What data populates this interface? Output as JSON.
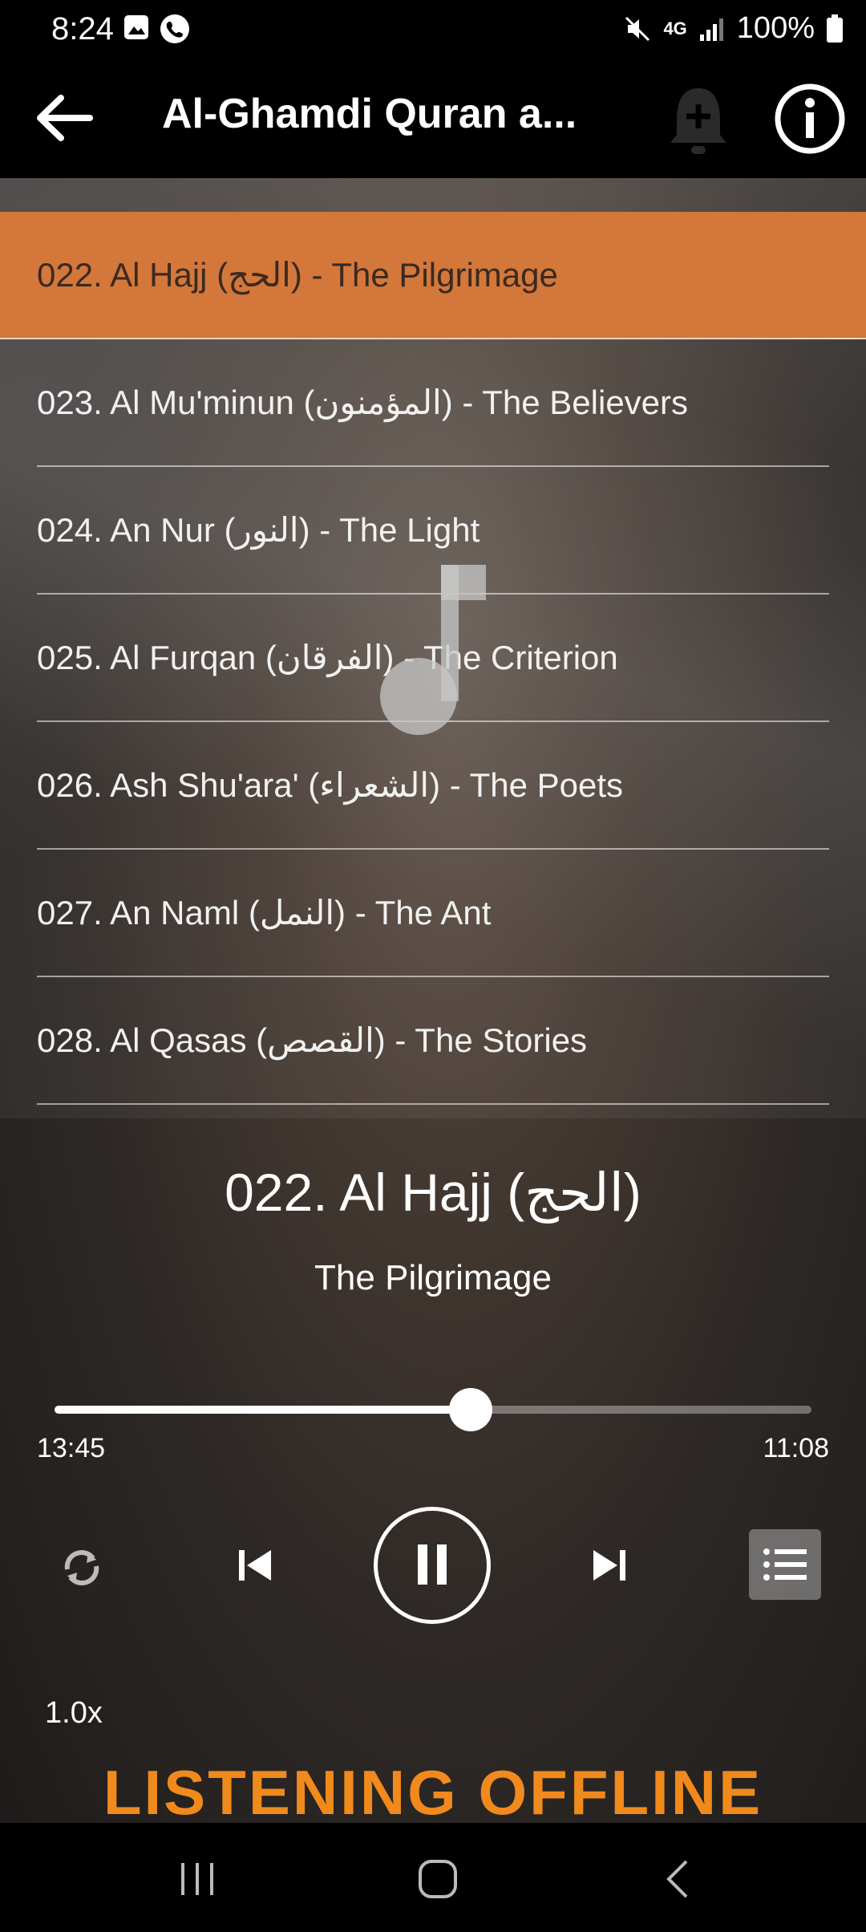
{
  "status_bar": {
    "time": "8:24",
    "network": "4G",
    "battery": "100%"
  },
  "app_bar": {
    "title": "Al-Ghamdi Quran a..."
  },
  "playlist": {
    "items": [
      {
        "label": "022. Al Hajj (الحج) - The Pilgrimage",
        "active": true
      },
      {
        "label": "023. Al Mu'minun (المؤمنون) - The Believers",
        "active": false
      },
      {
        "label": "024. An Nur (النور) - The Light",
        "active": false
      },
      {
        "label": "025. Al Furqan (الفرقان) - The Criterion",
        "active": false
      },
      {
        "label": "026. Ash Shu'ara' (الشعراء) - The Poets",
        "active": false
      },
      {
        "label": "027. An Naml (النمل) - The Ant",
        "active": false
      },
      {
        "label": "028. Al Qasas (القصص) - The Stories",
        "active": false
      }
    ]
  },
  "player": {
    "title": "022. Al Hajj (الحج)",
    "subtitle": "The Pilgrimage",
    "elapsed": "13:45",
    "remaining": "11:08",
    "progress": 0.55,
    "speed": "1.0x"
  },
  "banner": {
    "text": "LISTENING OFFLINE"
  },
  "colors": {
    "accent": "#d4773a",
    "banner": "#f08a1c"
  }
}
